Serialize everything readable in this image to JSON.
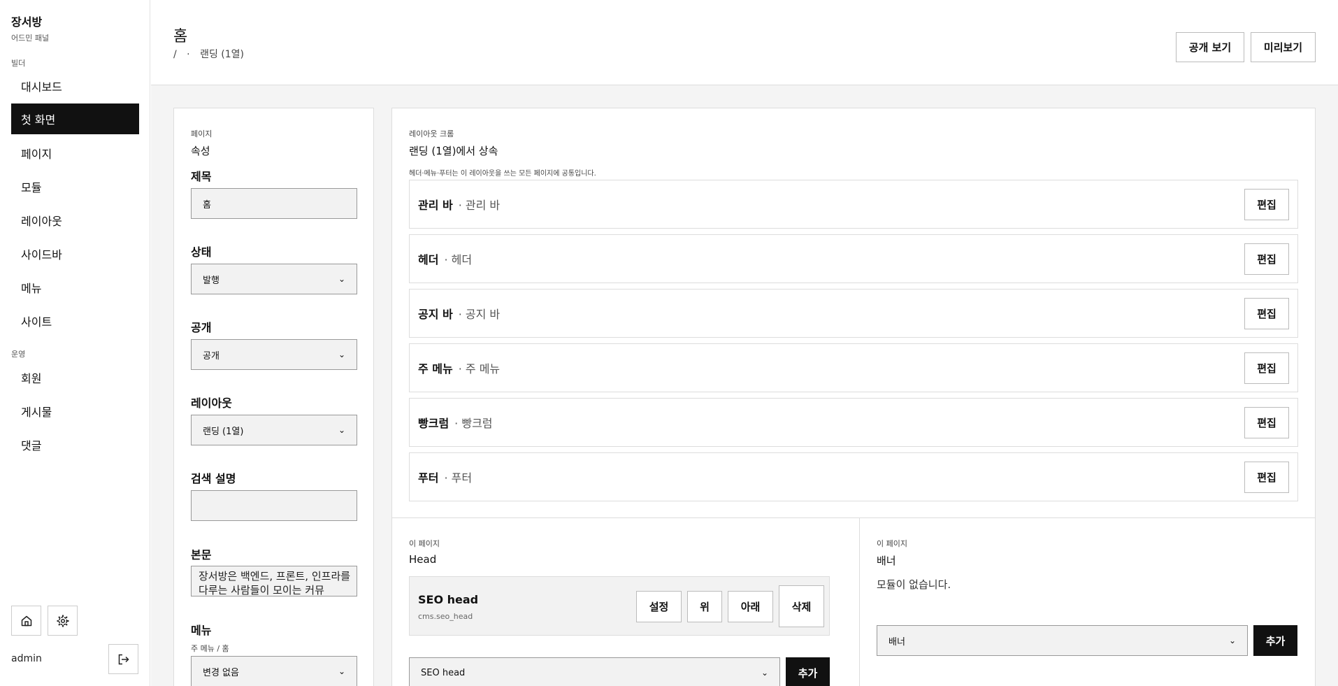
{
  "sidebar": {
    "brand": "장서방",
    "brand_sub": "어드민 패널",
    "section_builder": "빌더",
    "builder_items": [
      "대시보드",
      "첫 화면",
      "페이지",
      "모듈",
      "레이아웃",
      "사이드바",
      "메뉴",
      "사이트"
    ],
    "section_ops": "운영",
    "ops_items": [
      "회원",
      "게시물",
      "댓글"
    ],
    "active_item": "첫 화면",
    "admin_name": "admin"
  },
  "header": {
    "title": "홈",
    "breadcrumb_root": "/",
    "breadcrumb_sep": "·",
    "breadcrumb_current": "랜딩 (1열)",
    "public_view_label": "공개 보기",
    "preview_label": "미리보기"
  },
  "props": {
    "eyebrow": "페이지",
    "heading": "속성",
    "title_label": "제목",
    "title_value": "홈",
    "status_label": "상태",
    "status_value": "발행",
    "visibility_label": "공개",
    "visibility_value": "공개",
    "layout_label": "레이아웃",
    "layout_value": "랜딩 (1열)",
    "seo_label": "검색 설명",
    "seo_value": "",
    "body_label": "본문",
    "body_value": "장서방은 백엔드, 프론트, 인프라를 다루는 사람들이 모이는 커뮤",
    "menu_label": "메뉴",
    "menu_hint": "주 메뉴 / 홈",
    "menu_value": "변경 없음"
  },
  "layout_chrome": {
    "eyebrow": "레이아웃 크롬",
    "heading": "랜딩 (1열)에서 상속",
    "note": "헤더·메뉴·푸터는 이 레이아웃을 쓰는 모든 페이지에 공통입니다.",
    "edit_label": "편집",
    "rows": [
      {
        "name": "관리 바",
        "sub": "· 관리 바"
      },
      {
        "name": "헤더",
        "sub": "· 헤더"
      },
      {
        "name": "공지 바",
        "sub": "· 공지 바"
      },
      {
        "name": "주 메뉴",
        "sub": "· 주 메뉴"
      },
      {
        "name": "빵크럼",
        "sub": "· 빵크럼"
      },
      {
        "name": "푸터",
        "sub": "· 푸터"
      }
    ]
  },
  "head_region": {
    "eyebrow": "이 페이지",
    "heading": "Head",
    "module_name": "SEO head",
    "module_key": "cms.seo_head",
    "settings_label": "설정",
    "up_label": "위",
    "down_label": "아래",
    "delete_label": "삭제",
    "select_value": "SEO head",
    "add_label": "추가"
  },
  "banner_region": {
    "eyebrow": "이 페이지",
    "heading": "배너",
    "empty_text": "모듈이 없습니다.",
    "select_value": "배너",
    "add_label": "추가"
  }
}
